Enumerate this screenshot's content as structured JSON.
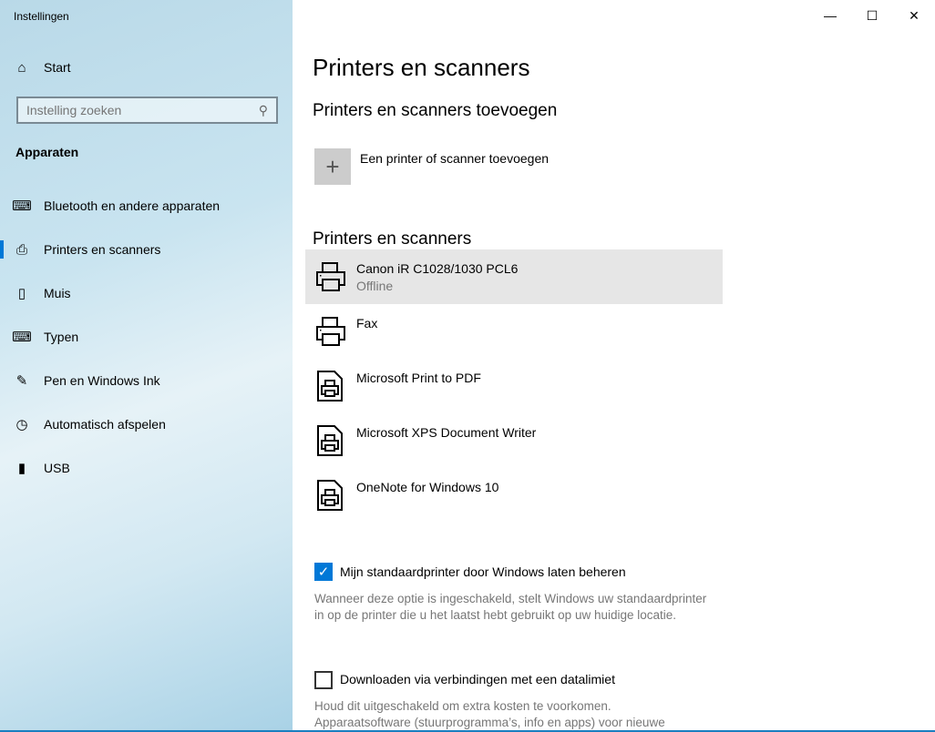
{
  "app_title": "Instellingen",
  "sidebar": {
    "home": "Start",
    "search_placeholder": "Instelling zoeken",
    "section": "Apparaten",
    "items": [
      {
        "label": "Bluetooth en andere apparaten",
        "icon": "bluetooth-devices-icon"
      },
      {
        "label": "Printers en scanners",
        "icon": "printer-icon",
        "active": true
      },
      {
        "label": "Muis",
        "icon": "mouse-icon"
      },
      {
        "label": "Typen",
        "icon": "keyboard-icon"
      },
      {
        "label": "Pen en Windows Ink",
        "icon": "pen-icon"
      },
      {
        "label": "Automatisch afspelen",
        "icon": "autoplay-icon"
      },
      {
        "label": "USB",
        "icon": "usb-icon"
      }
    ]
  },
  "main": {
    "title": "Printers en scanners",
    "add_heading": "Printers en scanners toevoegen",
    "add_label": "Een printer of scanner toevoegen",
    "list_heading": "Printers en scanners",
    "devices": [
      {
        "name": "Canon iR C1028/1030 PCL6",
        "status": "Offline",
        "type": "printer"
      },
      {
        "name": "Fax",
        "status": "",
        "type": "printer"
      },
      {
        "name": "Microsoft Print to PDF",
        "status": "",
        "type": "document"
      },
      {
        "name": "Microsoft XPS Document Writer",
        "status": "",
        "type": "document"
      },
      {
        "name": "OneNote for Windows 10",
        "status": "",
        "type": "document"
      }
    ],
    "default_printer": {
      "label": "Mijn standaardprinter door Windows laten beheren",
      "checked": true,
      "desc1": "Wanneer deze optie is ingeschakeld, stelt Windows uw standaardprinter",
      "desc2": "in op de printer die u het laatst hebt gebruikt op uw huidige locatie."
    },
    "metered": {
      "label": "Downloaden via verbindingen met een datalimiet",
      "checked": false,
      "desc1": "Houd dit uitgeschakeld om extra kosten te voorkomen.",
      "desc2": "Apparaatsoftware (stuurprogramma’s, info en apps) voor nieuwe"
    }
  },
  "colors": {
    "accent": "#0078d7"
  }
}
